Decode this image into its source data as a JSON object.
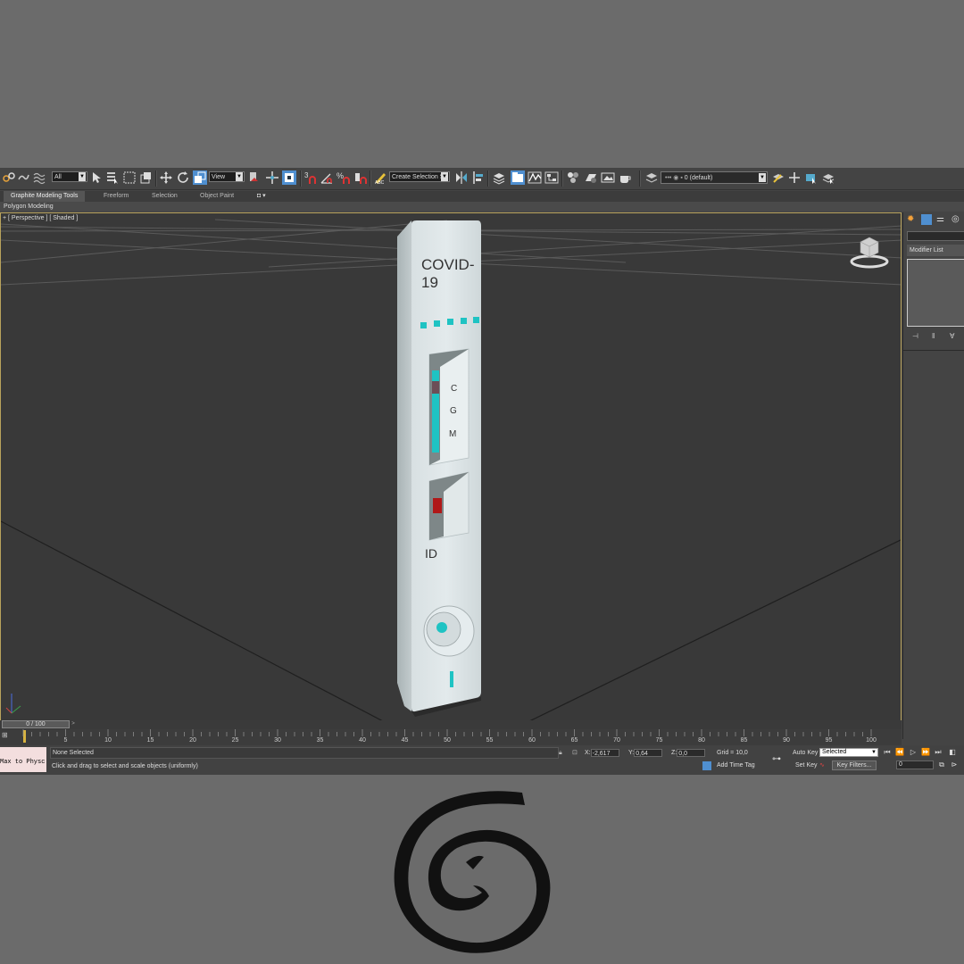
{
  "toolbar": {
    "selection_filter": "All",
    "reference_coord": "View",
    "named_selection": "Create Selection Se",
    "layer": "0 (default)",
    "snap_angle": "3",
    "snap_percent": "%"
  },
  "ribbon": {
    "tabs": [
      "Graphite Modeling Tools",
      "Freeform",
      "Selection",
      "Object Paint"
    ],
    "panel": "Polygon Modeling"
  },
  "viewport": {
    "label": "+ [ Perspective ] [ Shaded ]",
    "model": {
      "title": "COVID-19",
      "letters": [
        "C",
        "G",
        "M"
      ],
      "id_label": "ID"
    }
  },
  "command_panel": {
    "modifier_list": "Modifier List"
  },
  "timeline": {
    "frame": "0 / 100",
    "ticks": [
      "5",
      "10",
      "15",
      "20",
      "25",
      "30",
      "35",
      "40",
      "45",
      "50",
      "55",
      "60",
      "65",
      "70",
      "75",
      "80",
      "85",
      "90",
      "95",
      "100"
    ]
  },
  "status": {
    "maxscript": "Max to Physc",
    "selection": "None Selected",
    "prompt": "Click and drag to select and scale objects (uniformly)",
    "x_label": "X:",
    "x_value": "-2,617",
    "y_label": "Y:",
    "y_value": "0,64",
    "z_label": "Z:",
    "z_value": "0,0",
    "grid": "Grid = 10,0",
    "add_time_tag": "Add Time Tag",
    "auto_key": "Auto Key",
    "set_key": "Set Key",
    "key_mode": "Selected",
    "key_filters": "Key Filters...",
    "current_frame": "0"
  },
  "colors": {
    "accent_teal": "#1fc3c3",
    "marker_red": "#b01818",
    "viewport_border": "#b9a35c",
    "maxscript_bg": "#f3dede"
  }
}
